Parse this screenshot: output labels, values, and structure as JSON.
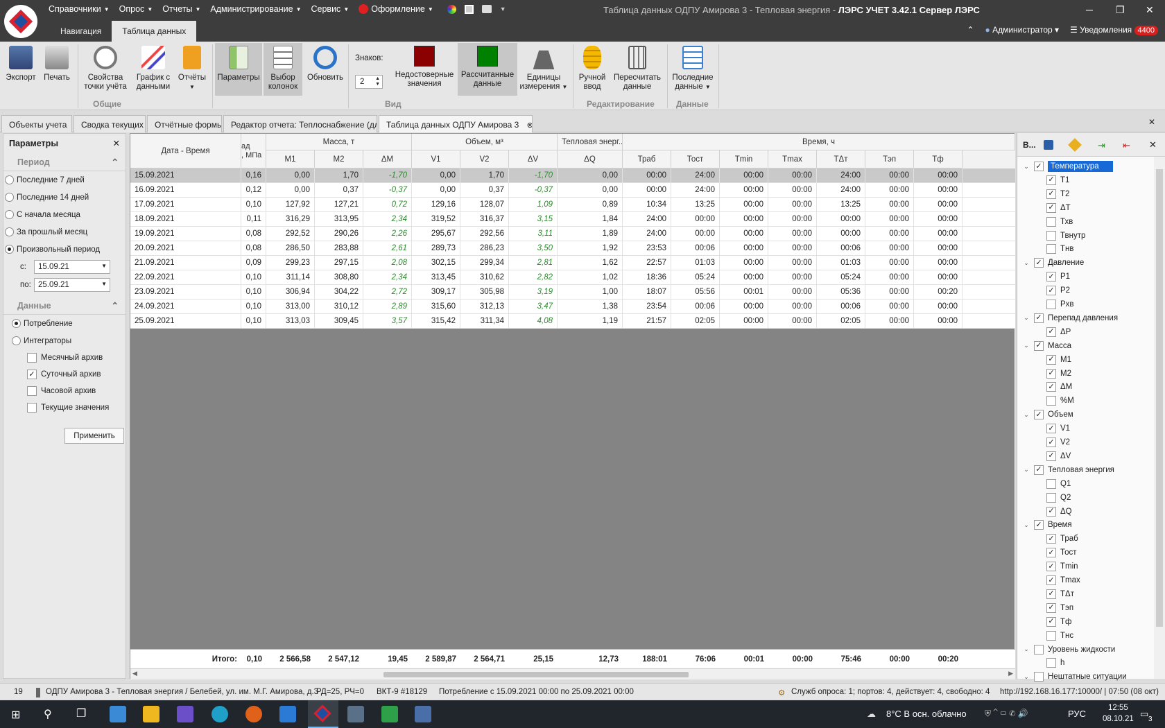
{
  "menu": {
    "items": [
      "Справочники",
      "Опрос",
      "Отчеты",
      "Администрирование",
      "Сервис",
      "Оформление"
    ]
  },
  "window": {
    "title_prefix": "Таблица данных ОДПУ Амирова 3 - Тепловая энергия - ",
    "title_app": "ЛЭРС УЧЕТ 3.42.1 Сервер ЛЭРС"
  },
  "nav": {
    "tabs": [
      "Навигация",
      "Таблица данных"
    ],
    "user": "Администратор",
    "notifications_label": "Уведомления",
    "notifications_count": "4400"
  },
  "ribbon": {
    "buttons": {
      "export": "Экспорт",
      "print": "Печать",
      "point_props": "Свойства\nточки учёта",
      "chart": "График с\nданными",
      "reports": "Отчёты",
      "params": "Параметры",
      "cols": "Выбор\nколонок",
      "refresh": "Обновить",
      "digits_label": "Знаков:",
      "digits_value": "2",
      "invalid": "Недостоверные\nзначения",
      "calculated": "Рассчитанные\nданные",
      "units": "Единицы\nизмерения",
      "manual": "Ручной\nввод",
      "recalc": "Пересчитать\nданные",
      "last": "Последние\nданные"
    },
    "groups": {
      "general": "Общие",
      "view": "Вид",
      "edit": "Редактирование",
      "data": "Данные"
    },
    "colors": {
      "invalid": "#8b0000",
      "calculated": "#008000"
    }
  },
  "doctabs": [
    "Объекты учета",
    "Сводка текущих",
    "Отчётные формы",
    "Редактор отчета: Теплоснабжение (дл",
    "Таблица данных ОДПУ Амирова 3"
  ],
  "left": {
    "title": "Параметры",
    "period_title": "Период",
    "periods": [
      "Последние 7 дней",
      "Последние 14 дней",
      "С начала месяца",
      "За прошлый месяц",
      "Произвольный период"
    ],
    "from_label": "с:",
    "from_value": "15.09.21",
    "to_label": "по:",
    "to_value": "25.09.21",
    "data_title": "Данные",
    "data_modes": [
      "Потребление",
      "Интеграторы"
    ],
    "archives": [
      "Месячный архив",
      "Суточный архив",
      "Часовой архив",
      "Текущие значения"
    ],
    "apply": "Применить"
  },
  "grid": {
    "groups": {
      "datetime": "Дата - Время",
      "pressure_top": "ад",
      "pressure_bottom": ", МПа",
      "mass": "Масса, т",
      "volume": "Объем, м³",
      "heat": "Тепловая энерг...",
      "time": "Время, ч"
    },
    "columns": [
      "М1",
      "М2",
      "ΔМ",
      "V1",
      "V2",
      "ΔV",
      "ΔQ",
      "Траб",
      "Тост",
      "Tmin",
      "Tmax",
      "ТΔт",
      "Тэп",
      "Тф"
    ],
    "rows": [
      [
        "15.09.2021",
        "0,16",
        "0,00",
        "1,70",
        "-1,70",
        "0,00",
        "1,70",
        "-1,70",
        "0,00",
        "00:00",
        "24:00",
        "00:00",
        "00:00",
        "24:00",
        "00:00",
        "00:00"
      ],
      [
        "16.09.2021",
        "0,12",
        "0,00",
        "0,37",
        "-0,37",
        "0,00",
        "0,37",
        "-0,37",
        "0,00",
        "00:00",
        "24:00",
        "00:00",
        "00:00",
        "24:00",
        "00:00",
        "00:00"
      ],
      [
        "17.09.2021",
        "0,10",
        "127,92",
        "127,21",
        "0,72",
        "129,16",
        "128,07",
        "1,09",
        "0,89",
        "10:34",
        "13:25",
        "00:00",
        "00:00",
        "13:25",
        "00:00",
        "00:00"
      ],
      [
        "18.09.2021",
        "0,11",
        "316,29",
        "313,95",
        "2,34",
        "319,52",
        "316,37",
        "3,15",
        "1,84",
        "24:00",
        "00:00",
        "00:00",
        "00:00",
        "00:00",
        "00:00",
        "00:00"
      ],
      [
        "19.09.2021",
        "0,08",
        "292,52",
        "290,26",
        "2,26",
        "295,67",
        "292,56",
        "3,11",
        "1,89",
        "24:00",
        "00:00",
        "00:00",
        "00:00",
        "00:00",
        "00:00",
        "00:00"
      ],
      [
        "20.09.2021",
        "0,08",
        "286,50",
        "283,88",
        "2,61",
        "289,73",
        "286,23",
        "3,50",
        "1,92",
        "23:53",
        "00:06",
        "00:00",
        "00:00",
        "00:06",
        "00:00",
        "00:00"
      ],
      [
        "21.09.2021",
        "0,09",
        "299,23",
        "297,15",
        "2,08",
        "302,15",
        "299,34",
        "2,81",
        "1,62",
        "22:57",
        "01:03",
        "00:00",
        "00:00",
        "01:03",
        "00:00",
        "00:00"
      ],
      [
        "22.09.2021",
        "0,10",
        "311,14",
        "308,80",
        "2,34",
        "313,45",
        "310,62",
        "2,82",
        "1,02",
        "18:36",
        "05:24",
        "00:00",
        "00:00",
        "05:24",
        "00:00",
        "00:00"
      ],
      [
        "23.09.2021",
        "0,10",
        "306,94",
        "304,22",
        "2,72",
        "309,17",
        "305,98",
        "3,19",
        "1,00",
        "18:07",
        "05:56",
        "00:01",
        "00:00",
        "05:36",
        "00:00",
        "00:20"
      ],
      [
        "24.09.2021",
        "0,10",
        "313,00",
        "310,12",
        "2,89",
        "315,60",
        "312,13",
        "3,47",
        "1,38",
        "23:54",
        "00:06",
        "00:00",
        "00:00",
        "00:06",
        "00:00",
        "00:00"
      ],
      [
        "25.09.2021",
        "0,10",
        "313,03",
        "309,45",
        "3,57",
        "315,42",
        "311,34",
        "4,08",
        "1,19",
        "21:57",
        "02:05",
        "00:00",
        "00:00",
        "02:05",
        "00:00",
        "00:00"
      ]
    ],
    "totals_label": "Итого:",
    "totals": [
      "0,10",
      "2 566,58",
      "2 547,12",
      "19,45",
      "2 589,87",
      "2 564,71",
      "25,15",
      "12,73",
      "188:01",
      "76:06",
      "00:01",
      "00:00",
      "75:46",
      "00:00",
      "00:20"
    ]
  },
  "right": {
    "title": "В...",
    "tree": [
      {
        "label": "Температура",
        "level": 0,
        "checked": true,
        "selected": true
      },
      {
        "label": "T1",
        "level": 1,
        "checked": true
      },
      {
        "label": "T2",
        "level": 1,
        "checked": true
      },
      {
        "label": "ΔT",
        "level": 1,
        "checked": true
      },
      {
        "label": "Тхв",
        "level": 1,
        "checked": false
      },
      {
        "label": "Твнутр",
        "level": 1,
        "checked": false
      },
      {
        "label": "Тнв",
        "level": 1,
        "checked": false
      },
      {
        "label": "Давление",
        "level": 0,
        "checked": true
      },
      {
        "label": "P1",
        "level": 1,
        "checked": true
      },
      {
        "label": "P2",
        "level": 1,
        "checked": true
      },
      {
        "label": "Рхв",
        "level": 1,
        "checked": false
      },
      {
        "label": "Перепад давления",
        "level": 0,
        "checked": true
      },
      {
        "label": "ΔP",
        "level": 1,
        "checked": true
      },
      {
        "label": "Масса",
        "level": 0,
        "checked": true
      },
      {
        "label": "M1",
        "level": 1,
        "checked": true
      },
      {
        "label": "M2",
        "level": 1,
        "checked": true
      },
      {
        "label": "ΔM",
        "level": 1,
        "checked": true
      },
      {
        "label": "%M",
        "level": 1,
        "checked": false
      },
      {
        "label": "Объем",
        "level": 0,
        "checked": true
      },
      {
        "label": "V1",
        "level": 1,
        "checked": true
      },
      {
        "label": "V2",
        "level": 1,
        "checked": true
      },
      {
        "label": "ΔV",
        "level": 1,
        "checked": true
      },
      {
        "label": "Тепловая энергия",
        "level": 0,
        "checked": true
      },
      {
        "label": "Q1",
        "level": 1,
        "checked": false
      },
      {
        "label": "Q2",
        "level": 1,
        "checked": false
      },
      {
        "label": "ΔQ",
        "level": 1,
        "checked": true
      },
      {
        "label": "Время",
        "level": 0,
        "checked": true
      },
      {
        "label": "Траб",
        "level": 1,
        "checked": true
      },
      {
        "label": "Тост",
        "level": 1,
        "checked": true
      },
      {
        "label": "Tmin",
        "level": 1,
        "checked": true
      },
      {
        "label": "Tmax",
        "level": 1,
        "checked": true
      },
      {
        "label": "ТΔт",
        "level": 1,
        "checked": true
      },
      {
        "label": "Тэп",
        "level": 1,
        "checked": true
      },
      {
        "label": "Тф",
        "level": 1,
        "checked": true
      },
      {
        "label": "Тнс",
        "level": 1,
        "checked": false
      },
      {
        "label": "Уровень жидкости",
        "level": 0,
        "checked": false
      },
      {
        "label": "h",
        "level": 1,
        "checked": false
      },
      {
        "label": "Нештатные ситуации",
        "level": 0,
        "checked": false
      }
    ]
  },
  "status": {
    "count": "19",
    "object": "ОДПУ Амирова 3 - Тепловая энергия / Белебей, ул. им. М.Г. Амирова, д.3",
    "rd": "РД=25, РЧ=0",
    "device": "ВКТ-9 #18129",
    "range": "Потребление с 15.09.2021 00:00 по 25.09.2021 00:00",
    "poll": "Служб опроса: 1; портов: 4, действует: 4, свободно: 4",
    "server": "http://192.168.16.177:10000/ | 07:50 (08 окт)"
  },
  "taskbar": {
    "weather": "8°C  В осн. облачно",
    "lang": "РУС",
    "time": "12:55",
    "date": "08.10.21",
    "notif": "3"
  }
}
